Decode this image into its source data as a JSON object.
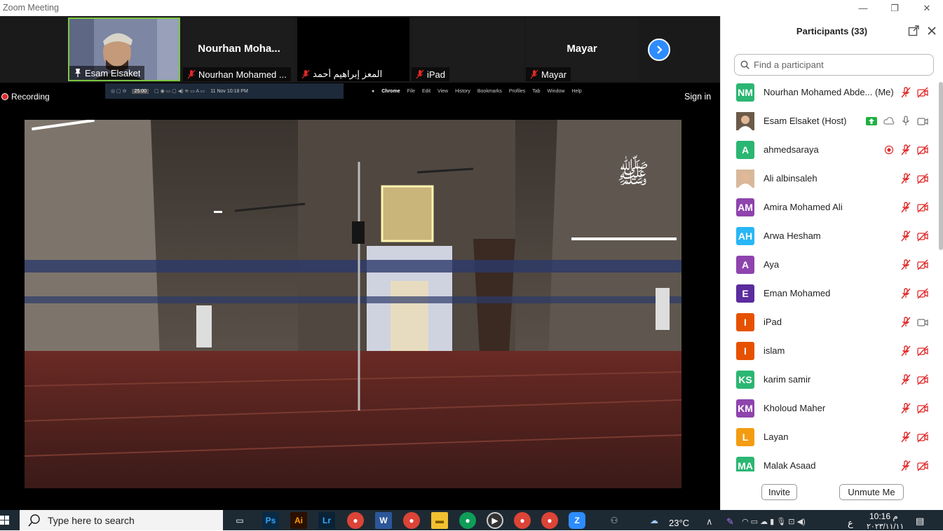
{
  "window": {
    "title": "Zoom Meeting",
    "minimize": "—",
    "restore": "❐",
    "close": "✕"
  },
  "thumbnails": [
    {
      "big_name": "",
      "label": "Esam Elsaket",
      "muted": false,
      "pinned": true
    },
    {
      "big_name": "Nourhan  Moha...",
      "label": "Nourhan Mohamed ...",
      "muted": true
    },
    {
      "big_name": "",
      "label": "المعز إبراهيم أحمد",
      "muted": true
    },
    {
      "big_name": "",
      "label": "iPad",
      "muted": true
    },
    {
      "big_name": "Mayar",
      "label": "Mayar",
      "muted": true
    }
  ],
  "share": {
    "recording": "Recording",
    "sign_in": "Sign in",
    "mac_menu": {
      "timer": "25:00",
      "date": "11 Nov  10:18 PM",
      "app": "Chrome",
      "items": [
        "File",
        "Edit",
        "View",
        "History",
        "Bookmarks",
        "Profiles",
        "Tab",
        "Window",
        "Help"
      ]
    }
  },
  "participants": {
    "title": "Participants (33)",
    "search_placeholder": "Find a participant",
    "list": [
      {
        "initials": "NM",
        "color": "#2bb673",
        "name": "Nourhan Mohamed Abde... (Me)",
        "audio": "muted",
        "video": "off"
      },
      {
        "initials": "",
        "color": "#6b5a4a",
        "name": "Esam Elsaket (Host)",
        "audio": "on",
        "video": "on",
        "photo": true,
        "sharing": true
      },
      {
        "initials": "A",
        "color": "#2bb673",
        "name": "ahmedsaraya",
        "audio": "muted",
        "video": "off",
        "recording": true
      },
      {
        "initials": "",
        "color": "#d9b89a",
        "name": "Ali albinsaleh",
        "audio": "muted",
        "video": "off",
        "photo": true
      },
      {
        "initials": "AM",
        "color": "#8e44ad",
        "name": "Amira Mohamed Ali",
        "audio": "muted",
        "video": "off"
      },
      {
        "initials": "AH",
        "color": "#29b6f6",
        "name": "Arwa Hesham",
        "audio": "muted",
        "video": "off"
      },
      {
        "initials": "A",
        "color": "#8e44ad",
        "name": "Aya",
        "audio": "muted",
        "video": "off"
      },
      {
        "initials": "E",
        "color": "#5b2c9e",
        "name": "Eman Mohamed",
        "audio": "muted",
        "video": "off"
      },
      {
        "initials": "I",
        "color": "#e65100",
        "name": "iPad",
        "audio": "muted",
        "video": "on"
      },
      {
        "initials": "I",
        "color": "#e65100",
        "name": "islam",
        "audio": "muted",
        "video": "off"
      },
      {
        "initials": "KS",
        "color": "#2bb673",
        "name": "karim samir",
        "audio": "muted",
        "video": "off"
      },
      {
        "initials": "KM",
        "color": "#8e44ad",
        "name": "Kholoud Maher",
        "audio": "muted",
        "video": "off"
      },
      {
        "initials": "L",
        "color": "#f39c12",
        "name": "Layan",
        "audio": "muted",
        "video": "off"
      },
      {
        "initials": "MA",
        "color": "#2bb673",
        "name": "Malak Asaad",
        "audio": "muted",
        "video": "off"
      }
    ],
    "invite": "Invite",
    "unmute": "Unmute Me"
  },
  "taskbar": {
    "search_placeholder": "Type here to search",
    "temperature": "23°C",
    "time": "10:16 م",
    "date": "٢٠٢٣/١١/١١",
    "lang": "ع"
  },
  "colors": {
    "zoom_blue": "#2d8cff",
    "active_green": "#7cc742",
    "mute_red": "#e02828"
  }
}
